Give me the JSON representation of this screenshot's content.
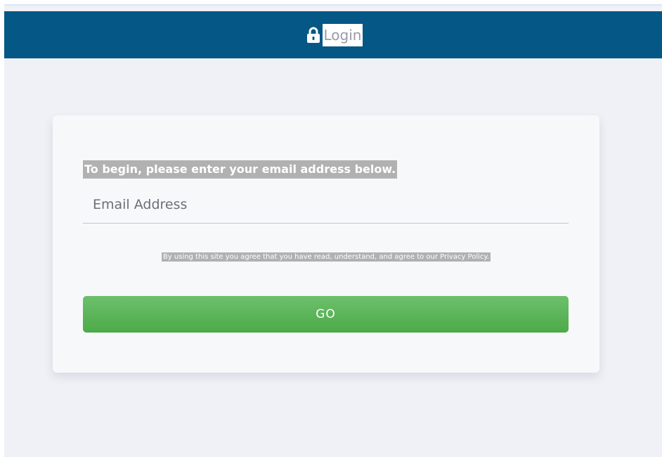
{
  "header": {
    "title": "Login",
    "icon": "lock-icon",
    "background_color": "#055786"
  },
  "login_form": {
    "prompt": "To begin, please enter your email address below.",
    "email": {
      "placeholder": "Email Address",
      "value": ""
    },
    "policy_notice": "By using this site you agree that you have read, understand, and agree to our Privacy Policy.",
    "submit_label": "GO",
    "submit_color": "#5cb85c"
  }
}
